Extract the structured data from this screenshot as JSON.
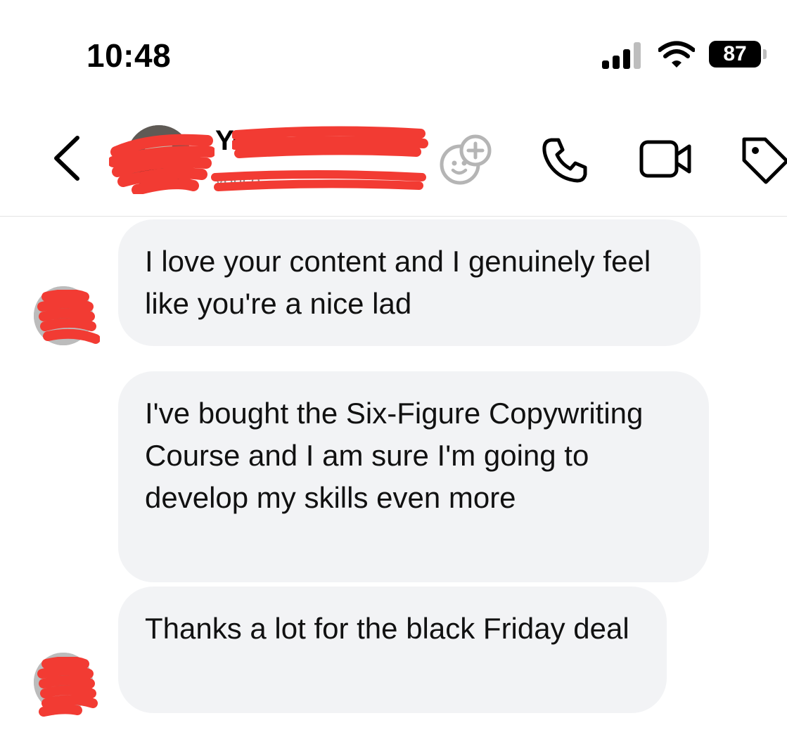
{
  "status_bar": {
    "time": "10:48",
    "battery": "87"
  },
  "header": {
    "contact_name": "Yo",
    "contact_subtitle": "youco",
    "icons": [
      "back-chevron-icon",
      "add-sticker-icon",
      "phone-icon",
      "video-icon",
      "tag-icon"
    ]
  },
  "messages": [
    {
      "text": "I love your content and I genuinely feel like you're a nice lad"
    },
    {
      "text": "I've bought the Six-Figure Copywriting Course and I am sure I'm going to develop my skills even more"
    },
    {
      "text": "Thanks a lot for the black Friday deal"
    }
  ],
  "colors": {
    "bubble": "#f2f3f5",
    "redaction": "#f23b33",
    "text": "#111111"
  }
}
